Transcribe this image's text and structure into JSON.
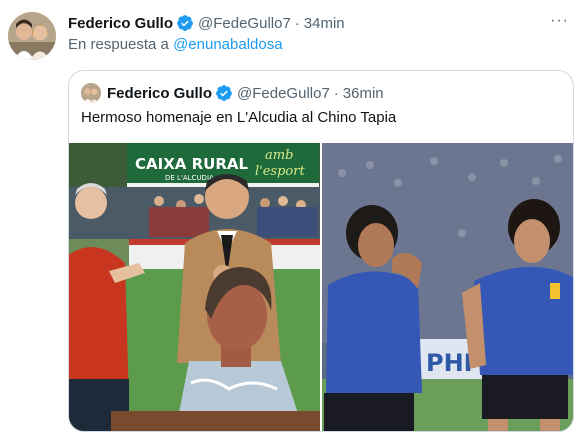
{
  "tweet": {
    "author_name": "Federico Gullo",
    "author_handle": "@FedeGullo7",
    "separator": "·",
    "time": "34min",
    "reply_prefix": "En respuesta a",
    "reply_handle": "@enunabaldosa",
    "more_label": "···"
  },
  "quoted": {
    "author_name": "Federico Gullo",
    "author_handle": "@FedeGullo7",
    "separator": "·",
    "time": "36min",
    "text": "Hermoso homenaje en L'Alcudia al Chino Tapia"
  },
  "photo_left": {
    "banner_line1": "CAIXA RURAL",
    "banner_line2": "DE L'ALCUDIA",
    "banner_script1": "amb",
    "banner_script2": "l'esport"
  },
  "photo_right": {
    "stand_text": "PHI"
  },
  "colors": {
    "accent": "#1d9bf0",
    "muted": "#536471",
    "border": "#cfd9de"
  }
}
